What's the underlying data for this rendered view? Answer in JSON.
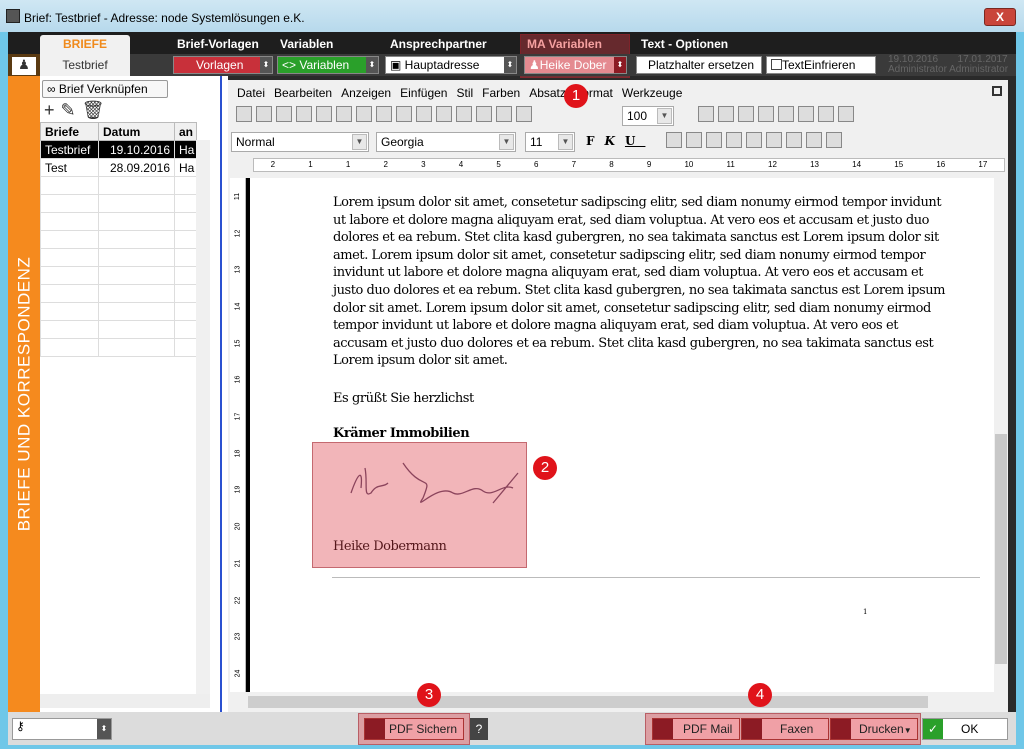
{
  "window": {
    "title": "Brief: Testbrief - Adresse: node Systemlösungen e.K.",
    "close": "X"
  },
  "tabs": [
    {
      "label": "BRIEFE"
    },
    {
      "label": "Brief-Vorlagen"
    },
    {
      "label": "Variablen"
    },
    {
      "label": "Ansprechpartner"
    },
    {
      "label": "MA Variablen"
    },
    {
      "label": "Text - Optionen"
    }
  ],
  "toolbar": {
    "current": "Testbrief",
    "vorlagen": "Vorlagen",
    "variablen": "<> Variablen",
    "adresse": "Hauptadresse",
    "mitarbeiter": "Heike Dober",
    "platzhalter": "Platzhalter ersetzen",
    "einfrieren": "TextEinfrieren",
    "date1": "19.10.2016",
    "date2": "17.01.2017",
    "user1": "Administrator",
    "user2": "Administrator"
  },
  "sidebar": {
    "vertical_label": "BRIEFE UND KORRESPONDENZ",
    "link_button": "Brief Verknüpfen",
    "columns": [
      "Briefe",
      "Datum",
      "an"
    ],
    "rows": [
      [
        "Testbrief",
        "19.10.2016",
        "Ha"
      ],
      [
        "Test",
        "28.09.2016",
        "Ha"
      ]
    ]
  },
  "editor": {
    "menu": [
      "Datei",
      "Bearbeiten",
      "Anzeigen",
      "Einfügen",
      "Stil",
      "Farben",
      "Absatz",
      "Format",
      "Werkzeuge"
    ],
    "zoom": "100",
    "style": "Normal",
    "font": "Georgia",
    "size": "11",
    "bold": "F",
    "italic": "K",
    "underline": "U",
    "ruler": [
      "2",
      "1",
      "1",
      "2",
      "3",
      "4",
      "5",
      "6",
      "7",
      "8",
      "9",
      "10",
      "11",
      "12",
      "13",
      "14",
      "15",
      "16",
      "17"
    ],
    "vruler": [
      "11",
      "12",
      "13",
      "14",
      "15",
      "16",
      "17",
      "18",
      "19",
      "20",
      "21",
      "22",
      "23",
      "24"
    ]
  },
  "document": {
    "lines": [
      "Lorem ipsum dolor sit amet, consetetur sadipscing elitr, sed diam nonumy eirmod tempor invidunt",
      "ut labore et dolore magna aliquyam erat, sed diam voluptua. At vero eos et accusam et justo duo",
      "dolores et ea rebum. Stet clita kasd gubergren, no sea takimata sanctus est Lorem ipsum dolor sit",
      "amet. Lorem ipsum dolor sit amet, consetetur sadipscing elitr, sed diam nonumy eirmod tempor",
      "invidunt ut labore et dolore magna aliquyam erat, sed diam voluptua. At vero eos et accusam et",
      "justo duo dolores et ea rebum. Stet clita kasd gubergren, no sea takimata sanctus est Lorem ipsum",
      "dolor sit amet. Lorem ipsum dolor sit amet, consetetur sadipscing elitr, sed diam nonumy eirmod",
      "tempor invidunt ut labore et dolore magna aliquyam erat, sed diam voluptua. At vero eos et",
      "accusam et justo duo dolores et ea rebum. Stet clita kasd gubergren, no sea takimata sanctus est",
      "Lorem ipsum dolor sit amet."
    ],
    "closing": "Es grüßt Sie herzlichst",
    "company": "Krämer Immobilien",
    "signer": "Heike Dobermann",
    "page_number": "1"
  },
  "badges": [
    "1",
    "2",
    "3",
    "4"
  ],
  "bottom": {
    "pdf_save": "PDF Sichern",
    "help": "?",
    "pdf_mail": "PDF Mail",
    "fax": "Faxen",
    "print": "Drucken",
    "ok": "OK"
  },
  "colors": {
    "accent": "#f58a1e",
    "highlight": "#e0131a",
    "vorlagen": "#c8303a",
    "variablen": "#2aa02a"
  }
}
